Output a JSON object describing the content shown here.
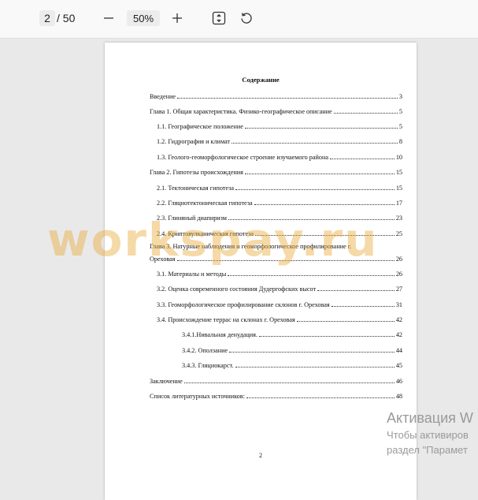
{
  "toolbar": {
    "page_current": "2",
    "page_total": "/ 50",
    "zoom": "50%"
  },
  "document": {
    "title": "Содержание",
    "page_number": "2",
    "toc": [
      {
        "text": "Введение",
        "page": "3",
        "level": 0
      },
      {
        "text": "Глава 1. Общая характеристика. Физико-географическое описание",
        "page": "5",
        "level": 0
      },
      {
        "text": "1.1. Географическое положение",
        "page": "5",
        "level": 1
      },
      {
        "text": "1.2. Гидрография и климат",
        "page": "8",
        "level": 1
      },
      {
        "text": "1.3. Геолого-геоморфологическое строение изучаемого района",
        "page": "10",
        "level": 1
      },
      {
        "text": "Глава 2. Гипотезы происхождения",
        "page": "15",
        "level": 0
      },
      {
        "text": "2.1. Тектоническая гипотеза",
        "page": "15",
        "level": 1
      },
      {
        "text": "2.2. Гляциотектоническая гипотеза",
        "page": "17",
        "level": 1
      },
      {
        "text": "2.3. Глиняный диапиризм",
        "page": "23",
        "level": 1
      },
      {
        "text": "2.4. Криптовулканическая гипотеза",
        "page": "25",
        "level": 1
      },
      {
        "text": "Ореховая",
        "page": "26",
        "level": 0
      },
      {
        "text": "3.1. Материалы и методы",
        "page": "26",
        "level": 1
      },
      {
        "text": "3.2. Оценка современного состояния Дудергофских высот",
        "page": "27",
        "level": 1
      },
      {
        "text": "3.3. Геоморфологическое профилирование склонов г. Ореховая",
        "page": "31",
        "level": 1
      },
      {
        "text": "3.4. Происхождение террас на склонах г. Ореховая",
        "page": "42",
        "level": 1
      },
      {
        "text": "3.4.1.Нивальная денудация.",
        "page": "42",
        "level": 2
      },
      {
        "text": "3.4.2. Оползание",
        "page": "44",
        "level": 2
      },
      {
        "text": "3.4.3. Гляциокарст.",
        "page": "45",
        "level": 2
      },
      {
        "text": "Заключение",
        "page": "46",
        "level": 0
      },
      {
        "text": "Список литературных источников:",
        "page": "48",
        "level": 0
      }
    ],
    "wrapped_heading": "Глава 3. Натурные наблюдения и геоморфологическое профилирование г."
  },
  "watermark": "workspay.ru",
  "activation": {
    "title": "Активация W",
    "line1": "Чтобы активиров",
    "line2": "раздел \"Парамет"
  },
  "icons": [
    "minus-icon",
    "plus-icon",
    "fit-page-icon",
    "rotate-icon"
  ]
}
